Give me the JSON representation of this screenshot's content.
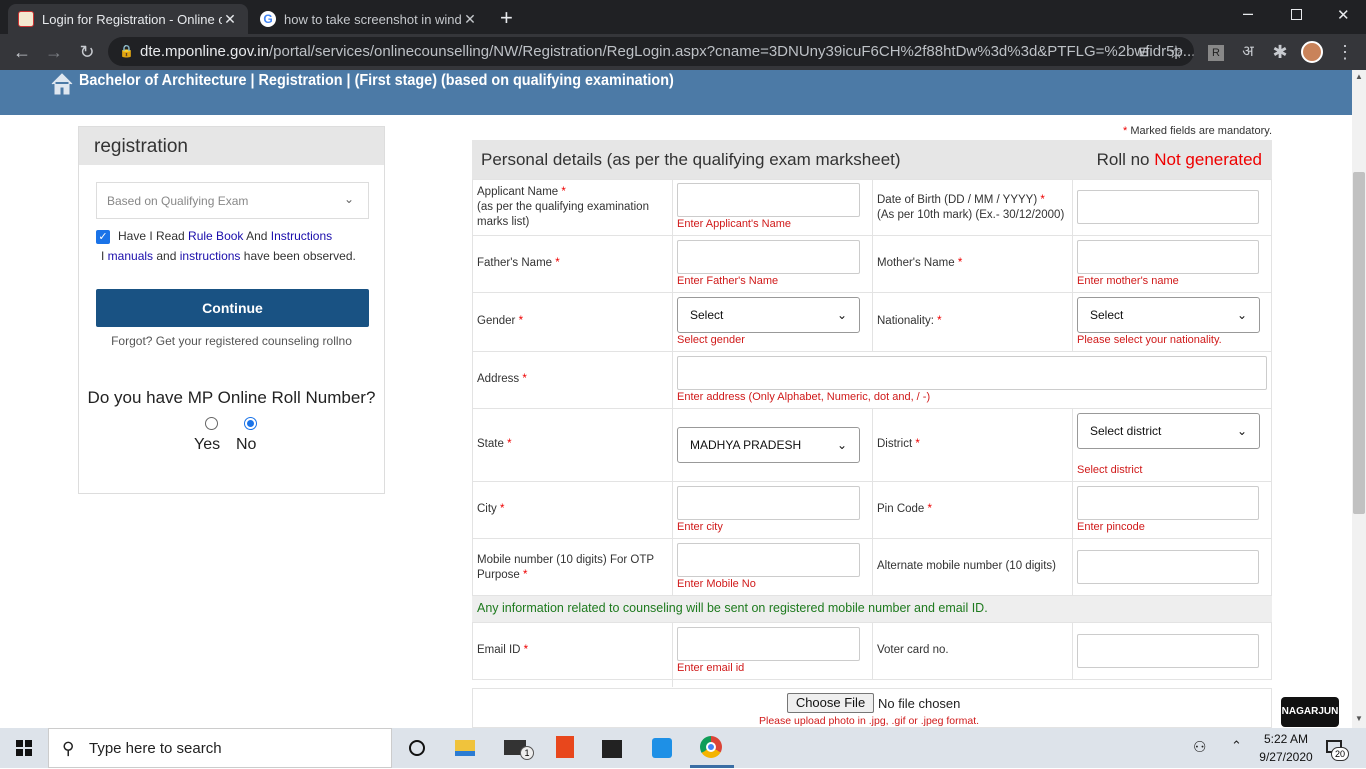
{
  "browser": {
    "tabs": [
      {
        "title": "Login for Registration - Online of",
        "active": true
      },
      {
        "title": "how to take screenshot in windo",
        "active": false
      }
    ],
    "address_domain": "dte.mponline.gov.in",
    "address_path": "/portal/services/onlinecounselling/NW/Registration/RegLogin.aspx?cname=3DNUny39icuF6CH%2f88htDw%3d%3d&PTFLG=%2bwfidr5p...",
    "ext_letter": "अ"
  },
  "page": {
    "banner_title": "Bachelor of Architecture | Registration | (First stage)  (based on qualifying examination)"
  },
  "left": {
    "heading": "registration",
    "select_placeholder": "Based on Qualifying Exam",
    "agree_prefix": "Have I Read ",
    "rule_book": "Rule Book",
    "and": " And ",
    "instructions": "Instructions",
    "line2_prefix": "I ",
    "manuals": "manuals",
    "line2_and": " and ",
    "instructions2": "instructions",
    "line2_suffix": " have been observed.",
    "continue": "Continue",
    "forgot": "Forgot? Get your registered counseling rollno",
    "question": "Do you have MP Online Roll Number?",
    "yes": "Yes",
    "no": "No",
    "selected": "No"
  },
  "form": {
    "mandatory_note": "Marked fields are mandatory.",
    "mandatory_star": "*",
    "section_title": "Personal details (as per the qualifying exam marksheet)",
    "roll_label": "Roll no",
    "roll_value": "Not generated",
    "applicant_label": "Applicant Name",
    "applicant_sub": "(as per the qualifying examination marks list)",
    "applicant_err": "Enter Applicant's Name",
    "dob_label": "Date of Birth (DD / MM / YYYY)",
    "dob_sub": "(As per 10th mark) (Ex.- 30/12/2000)",
    "father_label": "Father's Name",
    "father_err": "Enter Father's Name",
    "mother_label": "Mother's Name",
    "mother_err": "Enter mother's name",
    "gender_label": "Gender",
    "gender_value": "Select",
    "gender_err": "Select gender",
    "nationality_label": "Nationality:",
    "nationality_value": "Select",
    "nationality_err": "Please select your nationality.",
    "address_label": "Address",
    "address_err": "Enter address (Only Alphabet, Numeric, dot and, / -)",
    "state_label": "State",
    "state_value": "MADHYA PRADESH",
    "district_label": "District",
    "district_value": "Select district",
    "district_err": "Select district",
    "city_label": "City",
    "city_err": "Enter city",
    "pin_label": "Pin Code",
    "pin_err": "Enter pincode",
    "mobile_label": "Mobile number (10 digits) For OTP Purpose",
    "mobile_err": "Enter Mobile No",
    "alt_mobile_label": "Alternate mobile number (10 digits)",
    "info_note": "Any information related to counseling will be sent on registered mobile number and email ID.",
    "email_label": "Email ID",
    "email_err": "Enter email id",
    "voter_label": "Voter card no.",
    "choose_file": "Choose File",
    "no_file": "No file chosen",
    "photo_note": "Please upload photo in .jpg, .gif or .jpeg format."
  },
  "watermark": "NAGARJUN",
  "taskbar": {
    "search_placeholder": "Type here to search",
    "mail_badge": "1",
    "time": "5:22 AM",
    "date": "9/27/2020",
    "notif_count": "20"
  }
}
